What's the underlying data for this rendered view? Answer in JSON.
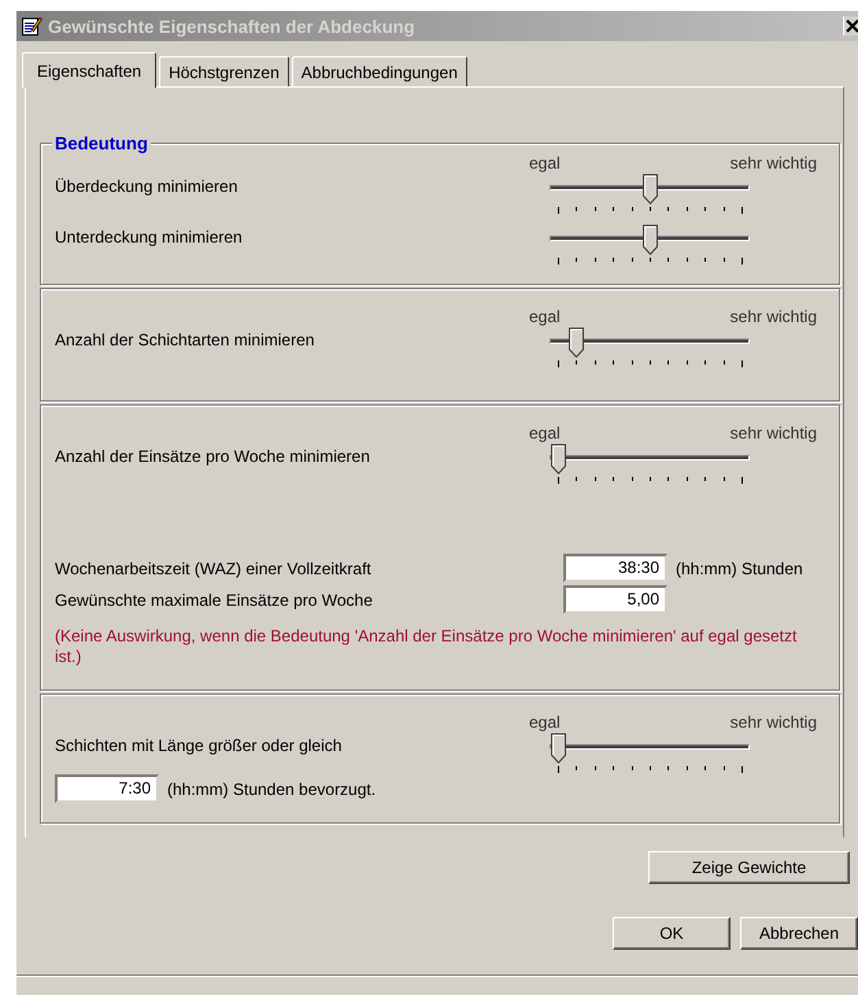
{
  "window": {
    "title": "Gewünschte Eigenschaften der Abdeckung"
  },
  "tabs": [
    {
      "label": "Eigenschaften",
      "selected": true
    },
    {
      "label": "Höchstgrenzen",
      "selected": false
    },
    {
      "label": "Abbruchbedingungen",
      "selected": false
    }
  ],
  "sections": [
    {
      "legend": "Bedeutung",
      "scale": {
        "low": "egal",
        "high": "sehr wichtig"
      },
      "rows": [
        {
          "kind": "slider",
          "label": "Überdeckung minimieren",
          "level": 0.5
        },
        {
          "kind": "slider",
          "label": "Unterdeckung minimieren",
          "level": 0.5
        }
      ]
    },
    {
      "scale": {
        "low": "egal",
        "high": "sehr wichtig"
      },
      "rows": [
        {
          "kind": "slider",
          "label": "Anzahl der Schichtarten minimieren",
          "level": 0.1
        }
      ]
    },
    {
      "scale": {
        "low": "egal",
        "high": "sehr wichtig"
      },
      "rows": [
        {
          "kind": "slider",
          "label": "Anzahl der Einsätze pro Woche minimieren",
          "level": 0
        },
        {
          "kind": "field",
          "label": "Wochenarbeitszeit (WAZ) einer Vollzeitkraft",
          "value": "38:30",
          "unit": "(hh:mm) Stunden"
        },
        {
          "kind": "field",
          "label": "Gewünschte maximale Einsätze pro Woche",
          "value": "5,00"
        },
        {
          "kind": "note",
          "text": "(Keine Auswirkung, wenn die Bedeutung 'Anzahl der Einsätze pro Woche minimieren' auf egal gesetzt ist.)"
        }
      ]
    },
    {
      "scale": {
        "low": "egal",
        "high": "sehr wichtig"
      },
      "rows": [
        {
          "kind": "slider",
          "label": "Schichten mit Länge größer oder gleich",
          "level": 0,
          "field": {
            "value": "7:30",
            "unit": "(hh:mm) Stunden bevorzugt."
          }
        }
      ]
    }
  ],
  "side_button": "Zeige Gewichte",
  "buttons": [
    "OK",
    "Abbrechen"
  ]
}
